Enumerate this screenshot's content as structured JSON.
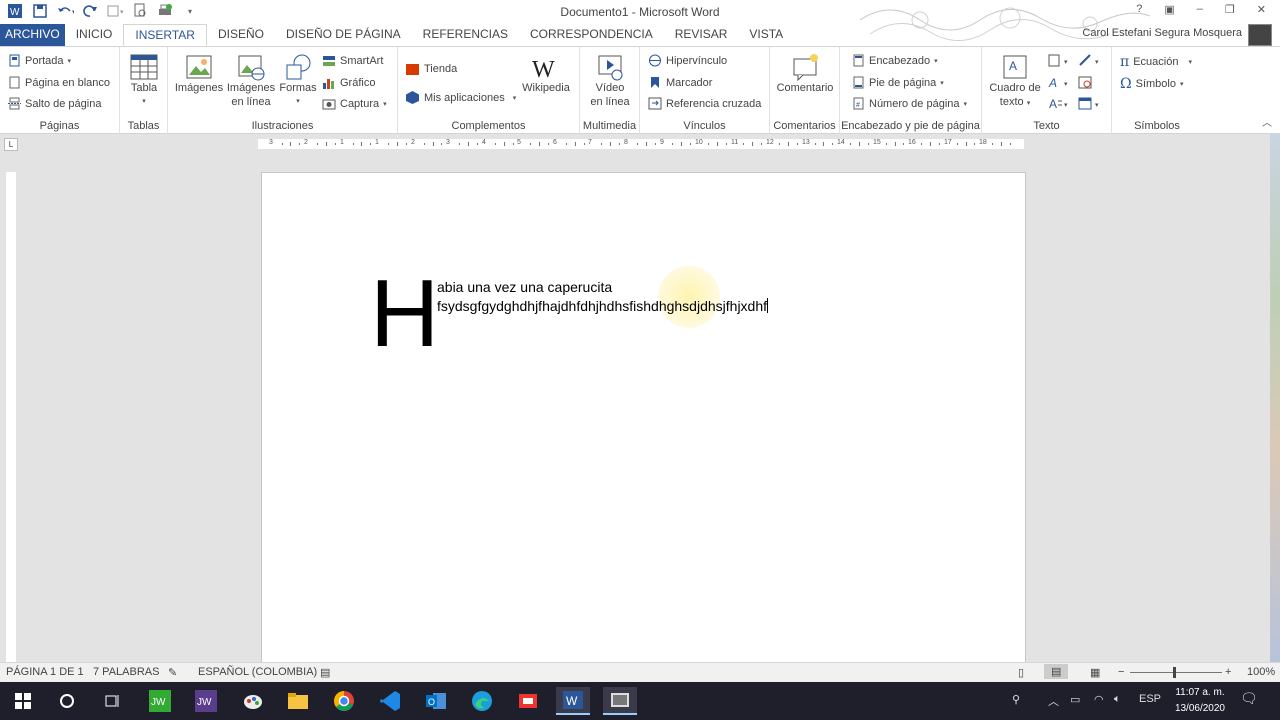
{
  "window": {
    "title": "Documento1 - Microsoft Word",
    "help": "?",
    "min": "–",
    "max": "❐",
    "close": "✕"
  },
  "tabs": [
    {
      "label": "ARCHIVO"
    },
    {
      "label": "INICIO"
    },
    {
      "label": "INSERTAR"
    },
    {
      "label": "DISEÑO"
    },
    {
      "label": "DISEÑO DE PÁGINA"
    },
    {
      "label": "REFERENCIAS"
    },
    {
      "label": "CORRESPONDENCIA"
    },
    {
      "label": "REVISAR"
    },
    {
      "label": "VISTA"
    }
  ],
  "user": {
    "name": "Carol Estefani Segura Mosquera"
  },
  "ribbon": {
    "paginas": {
      "label": "Páginas",
      "portada": "Portada",
      "pagina_blanco": "Página en blanco",
      "salto": "Salto de página"
    },
    "tablas": {
      "label": "Tablas",
      "tabla": "Tabla"
    },
    "ilustraciones": {
      "label": "Ilustraciones",
      "imagenes": "Imágenes",
      "imagenes_linea_1": "Imágenes",
      "imagenes_linea_2": "en línea",
      "formas": "Formas",
      "smartart": "SmartArt",
      "grafico": "Gráfico",
      "captura": "Captura"
    },
    "complementos": {
      "label": "Complementos",
      "tienda": "Tienda",
      "mis_apps": "Mis aplicaciones",
      "wikipedia": "Wikipedia"
    },
    "multimedia": {
      "label": "Multimedia",
      "video_1": "Vídeo",
      "video_2": "en línea"
    },
    "vinculos": {
      "label": "Vínculos",
      "hipervinculo": "Hipervínculo",
      "marcador": "Marcador",
      "referencia": "Referencia cruzada"
    },
    "comentarios": {
      "label": "Comentarios",
      "comentario": "Comentario"
    },
    "encabezado": {
      "label": "Encabezado y pie de página",
      "encabezado": "Encabezado",
      "pie": "Pie de página",
      "numero": "Número de página"
    },
    "texto": {
      "label": "Texto",
      "cuadro_1": "Cuadro de",
      "cuadro_2": "texto"
    },
    "simbolos": {
      "label": "Símbolos",
      "ecuacion": "Ecuación",
      "simbolo": "Símbolo"
    }
  },
  "ruler": {
    "ticks": [
      "3",
      "2",
      "1",
      "1",
      "2",
      "3",
      "4",
      "5",
      "6",
      "7",
      "8",
      "9",
      "10",
      "11",
      "12",
      "13",
      "14",
      "15",
      "16",
      "17",
      "18"
    ]
  },
  "document": {
    "dropcap": "H",
    "line1": "abia una vez una caperucita",
    "line2": "fsydsgfgydghdhjfhajdhfdhjhdhsfishdhghsdjdhsjfhjxdhf"
  },
  "status": {
    "page": "PÁGINA 1 DE 1",
    "words": "7 PALABRAS",
    "language": "ESPAÑOL (COLOMBIA)",
    "zoom": "100%"
  },
  "taskbar": {
    "time": "11:07 a. m.",
    "date": "13/06/2020",
    "lang": "ESP"
  },
  "colors": {
    "accent": "#2b579a",
    "taskbar": "#1f1f2b"
  }
}
